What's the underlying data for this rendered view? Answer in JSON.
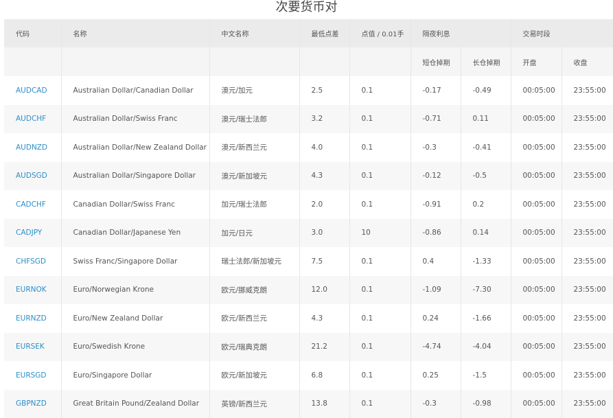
{
  "page": {
    "title": "次要货币对"
  },
  "table": {
    "headers": {
      "code": "代码",
      "name": "名称",
      "cn_name": "中文名称",
      "min_spread": "最低点差",
      "point_value": "点值 / 0.01手",
      "swap": "隔夜利息",
      "hours": "交易时段",
      "short": "短仓掉期",
      "long": "长仓掉期",
      "open": "开盘",
      "close": "收盘"
    },
    "rows": [
      {
        "code": "AUDCAD",
        "name": "Australian Dollar/Canadian Dollar",
        "cn": "澳元/加元",
        "min": "2.5",
        "pv": "0.1",
        "short": "-0.17",
        "long": "-0.49",
        "open": "00:05:00",
        "close": "23:55:00"
      },
      {
        "code": "AUDCHF",
        "name": "Australian Dollar/Swiss Franc",
        "cn": "澳元/瑞士法郎",
        "min": "3.2",
        "pv": "0.1",
        "short": "-0.71",
        "long": "0.11",
        "open": "00:05:00",
        "close": "23:55:00"
      },
      {
        "code": "AUDNZD",
        "name": "Australian Dollar/New Zealand Dollar",
        "cn": "澳元/新西兰元",
        "min": "4.0",
        "pv": "0.1",
        "short": "-0.3",
        "long": "-0.41",
        "open": "00:05:00",
        "close": "23:55:00"
      },
      {
        "code": "AUDSGD",
        "name": "Australian Dollar/Singapore Dollar",
        "cn": "澳元/新加坡元",
        "min": "4.3",
        "pv": "0.1",
        "short": "-0.12",
        "long": "-0.5",
        "open": "00:05:00",
        "close": "23:55:00"
      },
      {
        "code": "CADCHF",
        "name": "Canadian Dollar/Swiss Franc",
        "cn": "加元/瑞士法郎",
        "min": "2.0",
        "pv": "0.1",
        "short": "-0.91",
        "long": "0.2",
        "open": "00:05:00",
        "close": "23:55:00"
      },
      {
        "code": "CADJPY",
        "name": "Canadian Dollar/Japanese Yen",
        "cn": "加元/日元",
        "min": "3.0",
        "pv": "10",
        "short": "-0.86",
        "long": "0.14",
        "open": "00:05:00",
        "close": "23:55:00"
      },
      {
        "code": "CHFSGD",
        "name": "Swiss Franc/Singapore Dollar",
        "cn": "瑞士法郎/新加坡元",
        "min": "7.5",
        "pv": "0.1",
        "short": "0.4",
        "long": "-1.33",
        "open": "00:05:00",
        "close": "23:55:00"
      },
      {
        "code": "EURNOK",
        "name": "Euro/Norwegian Krone",
        "cn": "欧元/挪威克朗",
        "min": "12.0",
        "pv": "0.1",
        "short": "-1.09",
        "long": "-7.30",
        "open": "00:05:00",
        "close": "23:55:00"
      },
      {
        "code": "EURNZD",
        "name": "Euro/New Zealand Dollar",
        "cn": "欧元/新西兰元",
        "min": "4.3",
        "pv": "0.1",
        "short": "0.24",
        "long": "-1.66",
        "open": "00:05:00",
        "close": "23:55:00"
      },
      {
        "code": "EURSEK",
        "name": "Euro/Swedish Krone",
        "cn": "欧元/瑞典克朗",
        "min": "21.2",
        "pv": "0.1",
        "short": "-4.74",
        "long": "-4.04",
        "open": "00:05:00",
        "close": "23:55:00"
      },
      {
        "code": "EURSGD",
        "name": "Euro/Singapore Dollar",
        "cn": "欧元/新加坡元",
        "min": "6.8",
        "pv": "0.1",
        "short": "0.25",
        "long": "-1.5",
        "open": "00:05:00",
        "close": "23:55:00"
      },
      {
        "code": "GBPNZD",
        "name": "Great Britain Pound/Zealand Dollar",
        "cn": "英镑/新西兰元",
        "min": "13.8",
        "pv": "0.1",
        "short": "-0.3",
        "long": "-0.98",
        "open": "00:05:00",
        "close": "23:55:00"
      }
    ]
  }
}
